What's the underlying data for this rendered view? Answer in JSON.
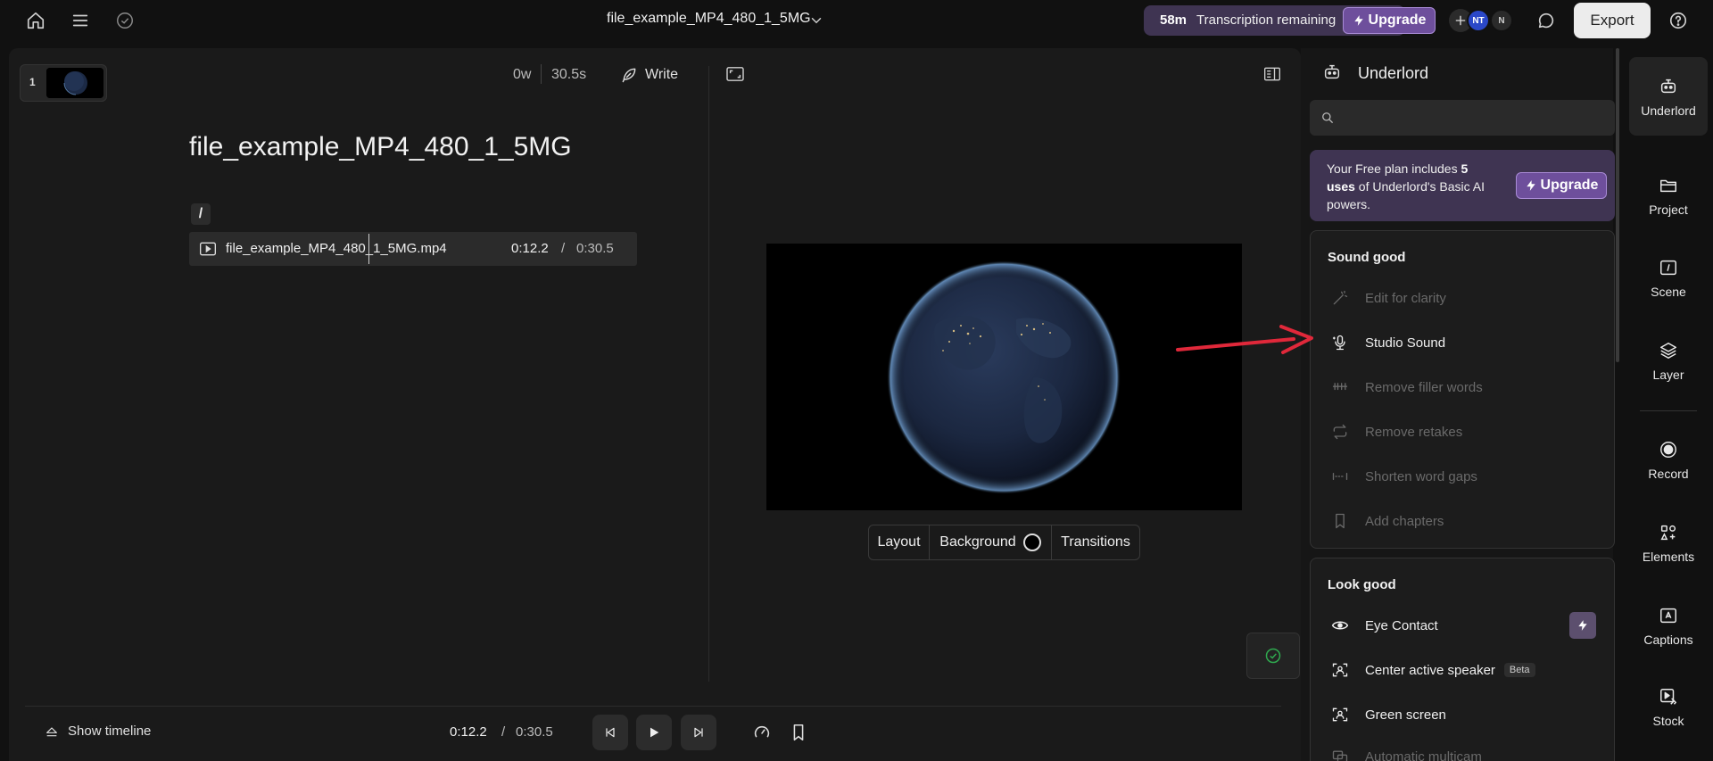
{
  "topbar": {
    "title": "file_example_MP4_480_1_5MG",
    "transcription_minutes": "58m",
    "transcription_label": "Transcription remaining",
    "upgrade_label": "Upgrade",
    "avatars": [
      "NT",
      "N"
    ],
    "export_label": "Export"
  },
  "scenes": [
    {
      "number": "1"
    }
  ],
  "editor": {
    "word_count": "0w",
    "duration": "30.5s",
    "write_label": "Write",
    "script_title": "file_example_MP4_480_1_5MG",
    "slash": "/",
    "clip": {
      "name": "file_example_MP4_480_1_5MG.mp4",
      "current": "0:12.2",
      "separator": "/",
      "total": "0:30.5"
    }
  },
  "canvas_toolbar": {
    "layout": "Layout",
    "background": "Background",
    "transitions": "Transitions"
  },
  "playback": {
    "show_timeline": "Show timeline",
    "current": "0:12.2",
    "separator": "/",
    "total": "0:30.5"
  },
  "underlord": {
    "title": "Underlord",
    "search_placeholder": "",
    "promo": {
      "text_1": "Your Free plan includes ",
      "bold": "5 uses",
      "text_2": " of Underlord's Basic AI powers.",
      "upgrade_label": "Upgrade"
    },
    "sound_good": {
      "heading": "Sound good",
      "items": [
        {
          "label": "Edit for clarity",
          "icon": "magic-wand-icon",
          "enabled": false
        },
        {
          "label": "Studio Sound",
          "icon": "studio-mic-icon",
          "enabled": true
        },
        {
          "label": "Remove filler words",
          "icon": "strikethrough-um-icon",
          "enabled": false
        },
        {
          "label": "Remove retakes",
          "icon": "repeat-icon",
          "enabled": false
        },
        {
          "label": "Shorten word gaps",
          "icon": "gap-icon",
          "enabled": false
        },
        {
          "label": "Add chapters",
          "icon": "bookmark-icon",
          "enabled": false
        }
      ]
    },
    "look_good": {
      "heading": "Look good",
      "items": [
        {
          "label": "Eye Contact",
          "icon": "eye-icon",
          "enabled": true
        },
        {
          "label": "Center active speaker",
          "icon": "center-speaker-icon",
          "enabled": true,
          "badge": "Beta"
        },
        {
          "label": "Green screen",
          "icon": "green-screen-icon",
          "enabled": true
        },
        {
          "label": "Automatic multicam",
          "icon": "multicam-icon",
          "enabled": false
        }
      ]
    }
  },
  "rail": {
    "items": [
      {
        "label": "Underlord",
        "icon": "robot-icon",
        "active": true
      },
      {
        "label": "Project",
        "icon": "folder-icon"
      },
      {
        "label": "Scene",
        "icon": "scene-icon"
      },
      {
        "label": "Layer",
        "icon": "layers-icon"
      },
      {
        "label": "Record",
        "icon": "record-icon"
      },
      {
        "label": "Elements",
        "icon": "elements-icon"
      },
      {
        "label": "Captions",
        "icon": "captions-icon"
      },
      {
        "label": "Stock",
        "icon": "stock-icon"
      }
    ]
  },
  "colors": {
    "accent_purple": "#6e4f9c",
    "promo_bg": "#3f3452",
    "annotation_arrow": "#e0283a",
    "saved_check": "#2faa4f"
  }
}
